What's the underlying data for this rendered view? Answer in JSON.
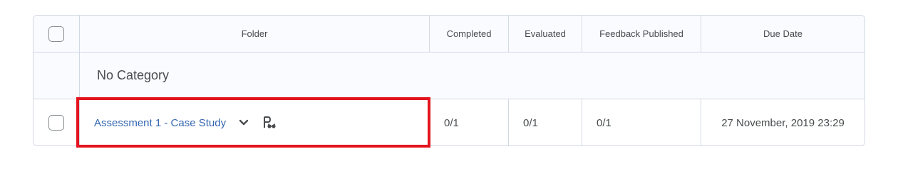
{
  "columns": {
    "folder": "Folder",
    "completed": "Completed",
    "evaluated": "Evaluated",
    "feedback_published": "Feedback Published",
    "due_date": "Due Date"
  },
  "category": {
    "label": "No Category"
  },
  "rows": [
    {
      "folder_name": "Assessment 1 - Case Study",
      "completed": "0/1",
      "evaluated": "0/1",
      "feedback_published": "0/1",
      "due_date": "27 November, 2019 23:29"
    }
  ],
  "icons": {
    "actions_menu": "chevron-down-icon",
    "special_access": "special-access-icon"
  },
  "colors": {
    "link": "#3567b0",
    "highlight": "#e3141e",
    "border": "#d3d9e3"
  }
}
